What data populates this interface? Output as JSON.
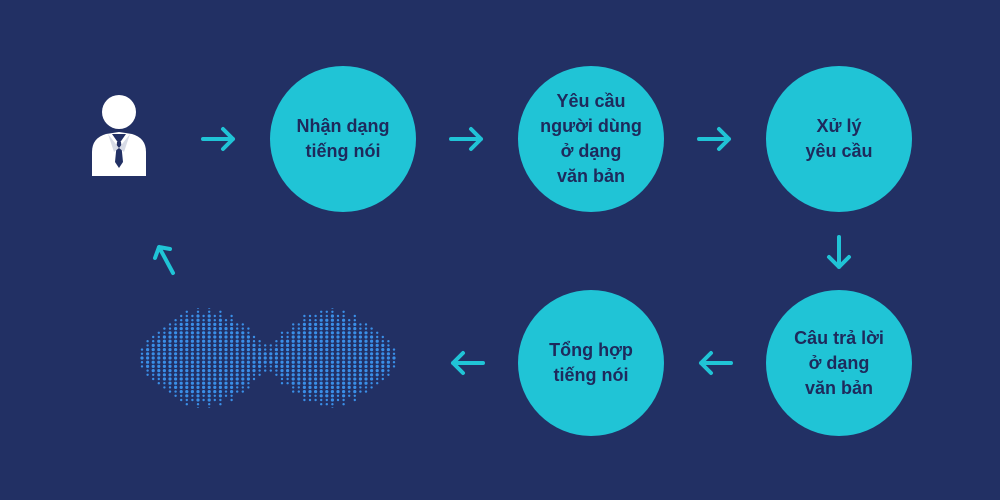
{
  "colors": {
    "background": "#223064",
    "node_fill": "#20c4d6",
    "node_text": "#1e2a5c",
    "arrow": "#20c4d6",
    "wave": "#3a8fe8",
    "user_icon": "#ffffff"
  },
  "diagram": {
    "nodes": [
      {
        "id": "speech-recognition",
        "label": "Nhận dạng\ntiếng nói"
      },
      {
        "id": "text-request",
        "label": "Yêu cầu\nngười dùng\nở dạng\nvăn bản"
      },
      {
        "id": "process-request",
        "label": "Xử lý\nyêu cầu"
      },
      {
        "id": "text-answer",
        "label": "Câu trả lời\nở dạng\nvăn bản"
      },
      {
        "id": "speech-synthesis",
        "label": "Tổng hợp\ntiếng nói"
      }
    ],
    "icons": {
      "user": "user-icon",
      "wave": "sound-wave-icon"
    }
  }
}
